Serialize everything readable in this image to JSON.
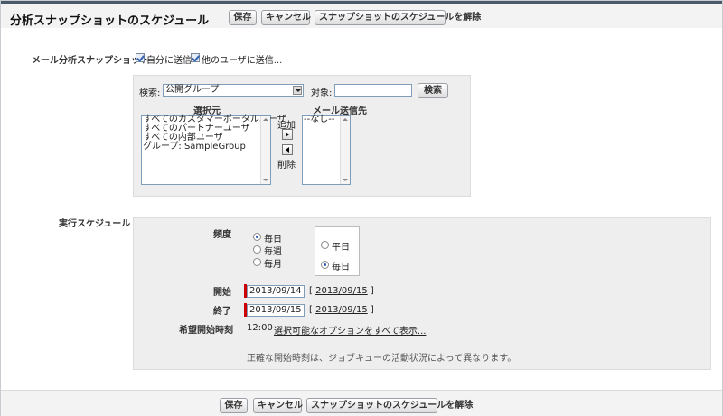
{
  "header": {
    "title": "分析スナップショットのスケジュール",
    "buttons": {
      "save": "保存",
      "cancel": "キャンセル",
      "unschedule": "スナップショットのスケジュールを解除"
    }
  },
  "email": {
    "label": "メール分析スナップショット",
    "send_self": {
      "label": "自分に送信",
      "checked": true
    },
    "send_others": {
      "label": "他のユーザに送信...",
      "checked": true
    },
    "search_label": "検索:",
    "search_select_value": "公開グループ",
    "for_label": "対象:",
    "for_value": "",
    "find_button": "検索",
    "available_header": "選択元",
    "available_items": [
      "すべてのカスタマーポータルユーザ",
      "すべてのパートナーユーザ",
      "すべての内部ユーザ",
      "グループ: SampleGroup"
    ],
    "add_label": "追加",
    "remove_label": "削除",
    "recipients_header": "メール送信先",
    "recipients_items": [
      "--なし--"
    ]
  },
  "schedule": {
    "label": "実行スケジュール",
    "frequency_label": "頻度",
    "frequency_options": [
      "毎日",
      "毎週",
      "毎月"
    ],
    "frequency_selected": "毎日",
    "daily_options": [
      "平日",
      "毎日"
    ],
    "daily_selected": "毎日",
    "start_label": "開始",
    "start_value": "2013/09/14",
    "start_link": "2013/09/15",
    "end_label": "終了",
    "end_value": "2013/09/15",
    "end_link": "2013/09/15",
    "preferred_label": "希望開始時刻",
    "preferred_time": "12:00",
    "show_options_link": "選択可能なオプションをすべて表示...",
    "note": "正確な開始時刻は、ジョブキューの活動状況によって異なります。"
  },
  "colors": {
    "required": "#cc0000",
    "topbar_border": "#4b5a6a",
    "panel_bg": "#eeeeee"
  }
}
